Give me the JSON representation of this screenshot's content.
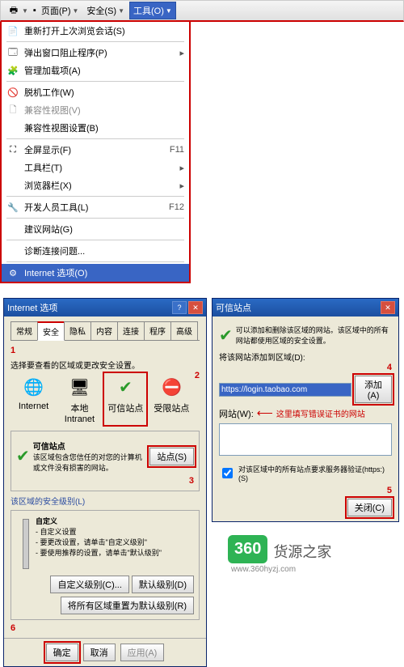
{
  "toolbar": {
    "page": "页面(P)",
    "safety": "安全(S)",
    "tools": "工具(O)"
  },
  "menu": {
    "reopen": "重新打开上次浏览会话(S)",
    "popup": "弹出窗口阻止程序(P)",
    "addons": "管理加载项(A)",
    "offline": "脱机工作(W)",
    "compat": "兼容性视图(V)",
    "compat_settings": "兼容性视图设置(B)",
    "fullscreen": "全屏显示(F)",
    "fullscreen_key": "F11",
    "toolbars": "工具栏(T)",
    "explorer": "浏览器栏(X)",
    "devtools": "开发人员工具(L)",
    "devtools_key": "F12",
    "suggested": "建议网站(G)",
    "diagnose": "诊断连接问题...",
    "options": "Internet 选项(O)"
  },
  "dlg1": {
    "title": "Internet 选项",
    "tabs": [
      "常规",
      "安全",
      "隐私",
      "内容",
      "连接",
      "程序",
      "高级"
    ],
    "prompt": "选择要查看的区域或更改安全设置。",
    "zones": {
      "internet": "Internet",
      "local": "本地 Intranet",
      "trusted": "可信站点",
      "restricted": "受限站点"
    },
    "trusted_title": "可信站点",
    "trusted_desc": "该区域包含您信任的对您的计算机或文件没有损害的网站。",
    "sites_btn": "站点(S)",
    "level_label": "该区域的安全级别(L)",
    "custom_title": "自定义",
    "custom_line1": "- 自定义设置",
    "custom_line2": "- 要更改设置，请单击\"自定义级别\"",
    "custom_line3": "- 要使用推荐的设置，请单击\"默认级别\"",
    "custom_btn": "自定义级别(C)...",
    "default_btn": "默认级别(D)",
    "reset_btn": "将所有区域重置为默认级别(R)",
    "ok": "确定",
    "cancel": "取消",
    "apply": "应用(A)"
  },
  "dlg2": {
    "title": "可信站点",
    "desc": "可以添加和删除该区域的网站。该区域中的所有网站都使用区域的安全设置。",
    "add_label": "将该网站添加到区域(D):",
    "url_value": "https://login.taobao.com",
    "add_btn": "添加(A)",
    "list_label": "网站(W):",
    "hint": "这里填写错误证书的网站",
    "verify": "对该区域中的所有站点要求服务器验证(https:)(S)",
    "close": "关闭(C)"
  },
  "nums": {
    "n1": "1",
    "n2": "2",
    "n3": "3",
    "n4": "4",
    "n5": "5",
    "n6": "6"
  },
  "logo": {
    "badge": "360",
    "text": "货源之家",
    "url": "www.360hyzj.com"
  }
}
